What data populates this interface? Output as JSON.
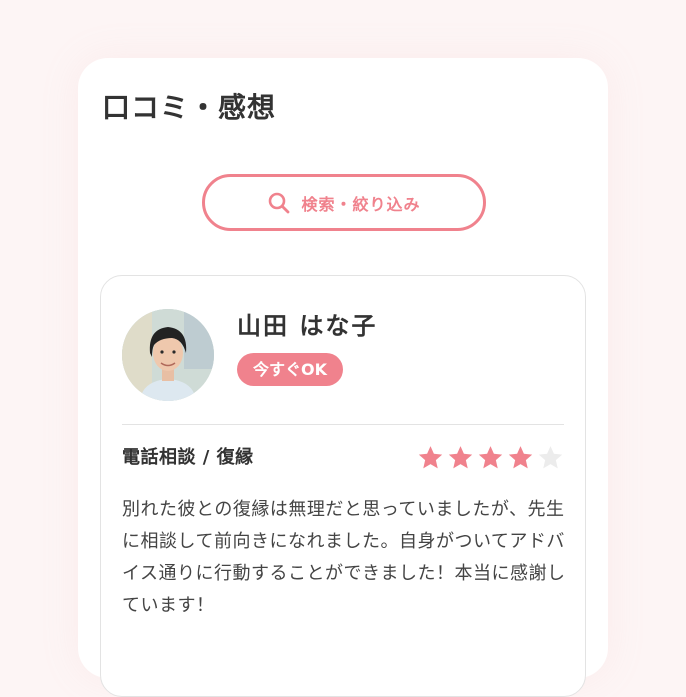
{
  "section": {
    "title": "口コミ・感想"
  },
  "search": {
    "label": "検索・絞り込み",
    "icon": "search-icon",
    "color": "#f0828d"
  },
  "review": {
    "reviewer_name": "山田 はな子",
    "status_badge": "今すぐOK",
    "category": "電話相談 / 復縁",
    "rating": 4,
    "rating_max": 5,
    "text": "別れた彼との復縁は無理だと思っていましたが、先生に相談して前向きになれました。自身がついてアドバイス通りに行動することができました！本当に感謝しています！",
    "star_color": "#f0828d",
    "star_empty_color": "#ececec"
  }
}
